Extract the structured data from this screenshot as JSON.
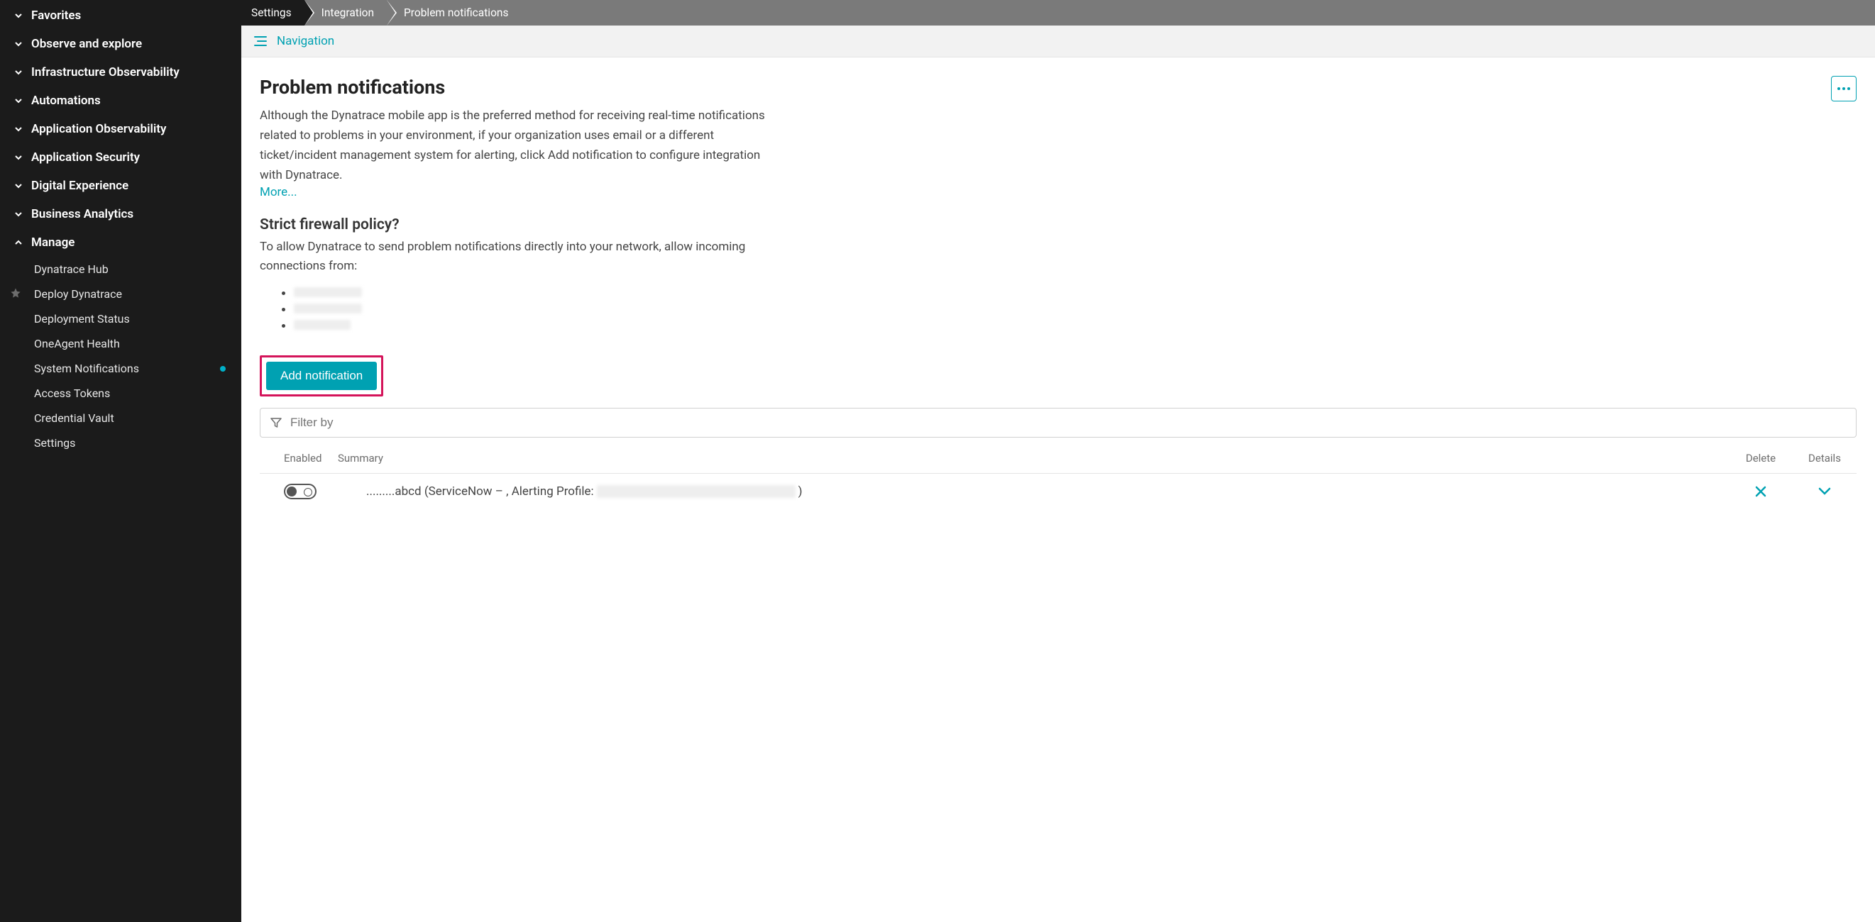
{
  "sidebar": {
    "sections": [
      {
        "label": "Favorites",
        "expanded": false
      },
      {
        "label": "Observe and explore",
        "expanded": false
      },
      {
        "label": "Infrastructure Observability",
        "expanded": false
      },
      {
        "label": "Automations",
        "expanded": false
      },
      {
        "label": "Application Observability",
        "expanded": false
      },
      {
        "label": "Application Security",
        "expanded": false
      },
      {
        "label": "Digital Experience",
        "expanded": false
      },
      {
        "label": "Business Analytics",
        "expanded": false
      },
      {
        "label": "Manage",
        "expanded": true
      }
    ],
    "manage_items": [
      {
        "label": "Dynatrace Hub",
        "star": false,
        "dot": false
      },
      {
        "label": "Deploy Dynatrace",
        "star": true,
        "dot": false
      },
      {
        "label": "Deployment Status",
        "star": false,
        "dot": false
      },
      {
        "label": "OneAgent Health",
        "star": false,
        "dot": false
      },
      {
        "label": "System Notifications",
        "star": false,
        "dot": true
      },
      {
        "label": "Access Tokens",
        "star": false,
        "dot": false
      },
      {
        "label": "Credential Vault",
        "star": false,
        "dot": false
      },
      {
        "label": "Settings",
        "star": false,
        "dot": false
      }
    ]
  },
  "breadcrumbs": [
    "Settings",
    "Integration",
    "Problem notifications"
  ],
  "navigation_label": "Navigation",
  "page": {
    "title": "Problem notifications",
    "description": "Although the Dynatrace mobile app is the preferred method for receiving real-time notifications related to problems in your environment, if your organization uses email or a different ticket/incident management system for alerting, click Add notification to configure integration with Dynatrace.",
    "more_label": "More...",
    "firewall_heading": "Strict firewall policy?",
    "firewall_text": "To allow Dynatrace to send problem notifications directly into your network, allow incoming connections from:",
    "add_button": "Add notification",
    "filter_placeholder": "Filter by"
  },
  "table": {
    "headers": {
      "enabled": "Enabled",
      "summary": "Summary",
      "delete": "Delete",
      "details": "Details"
    },
    "rows": [
      {
        "enabled": false,
        "summary_prefix": ".........abcd (ServiceNow – , Alerting Profile:",
        "summary_suffix": ")"
      }
    ]
  }
}
